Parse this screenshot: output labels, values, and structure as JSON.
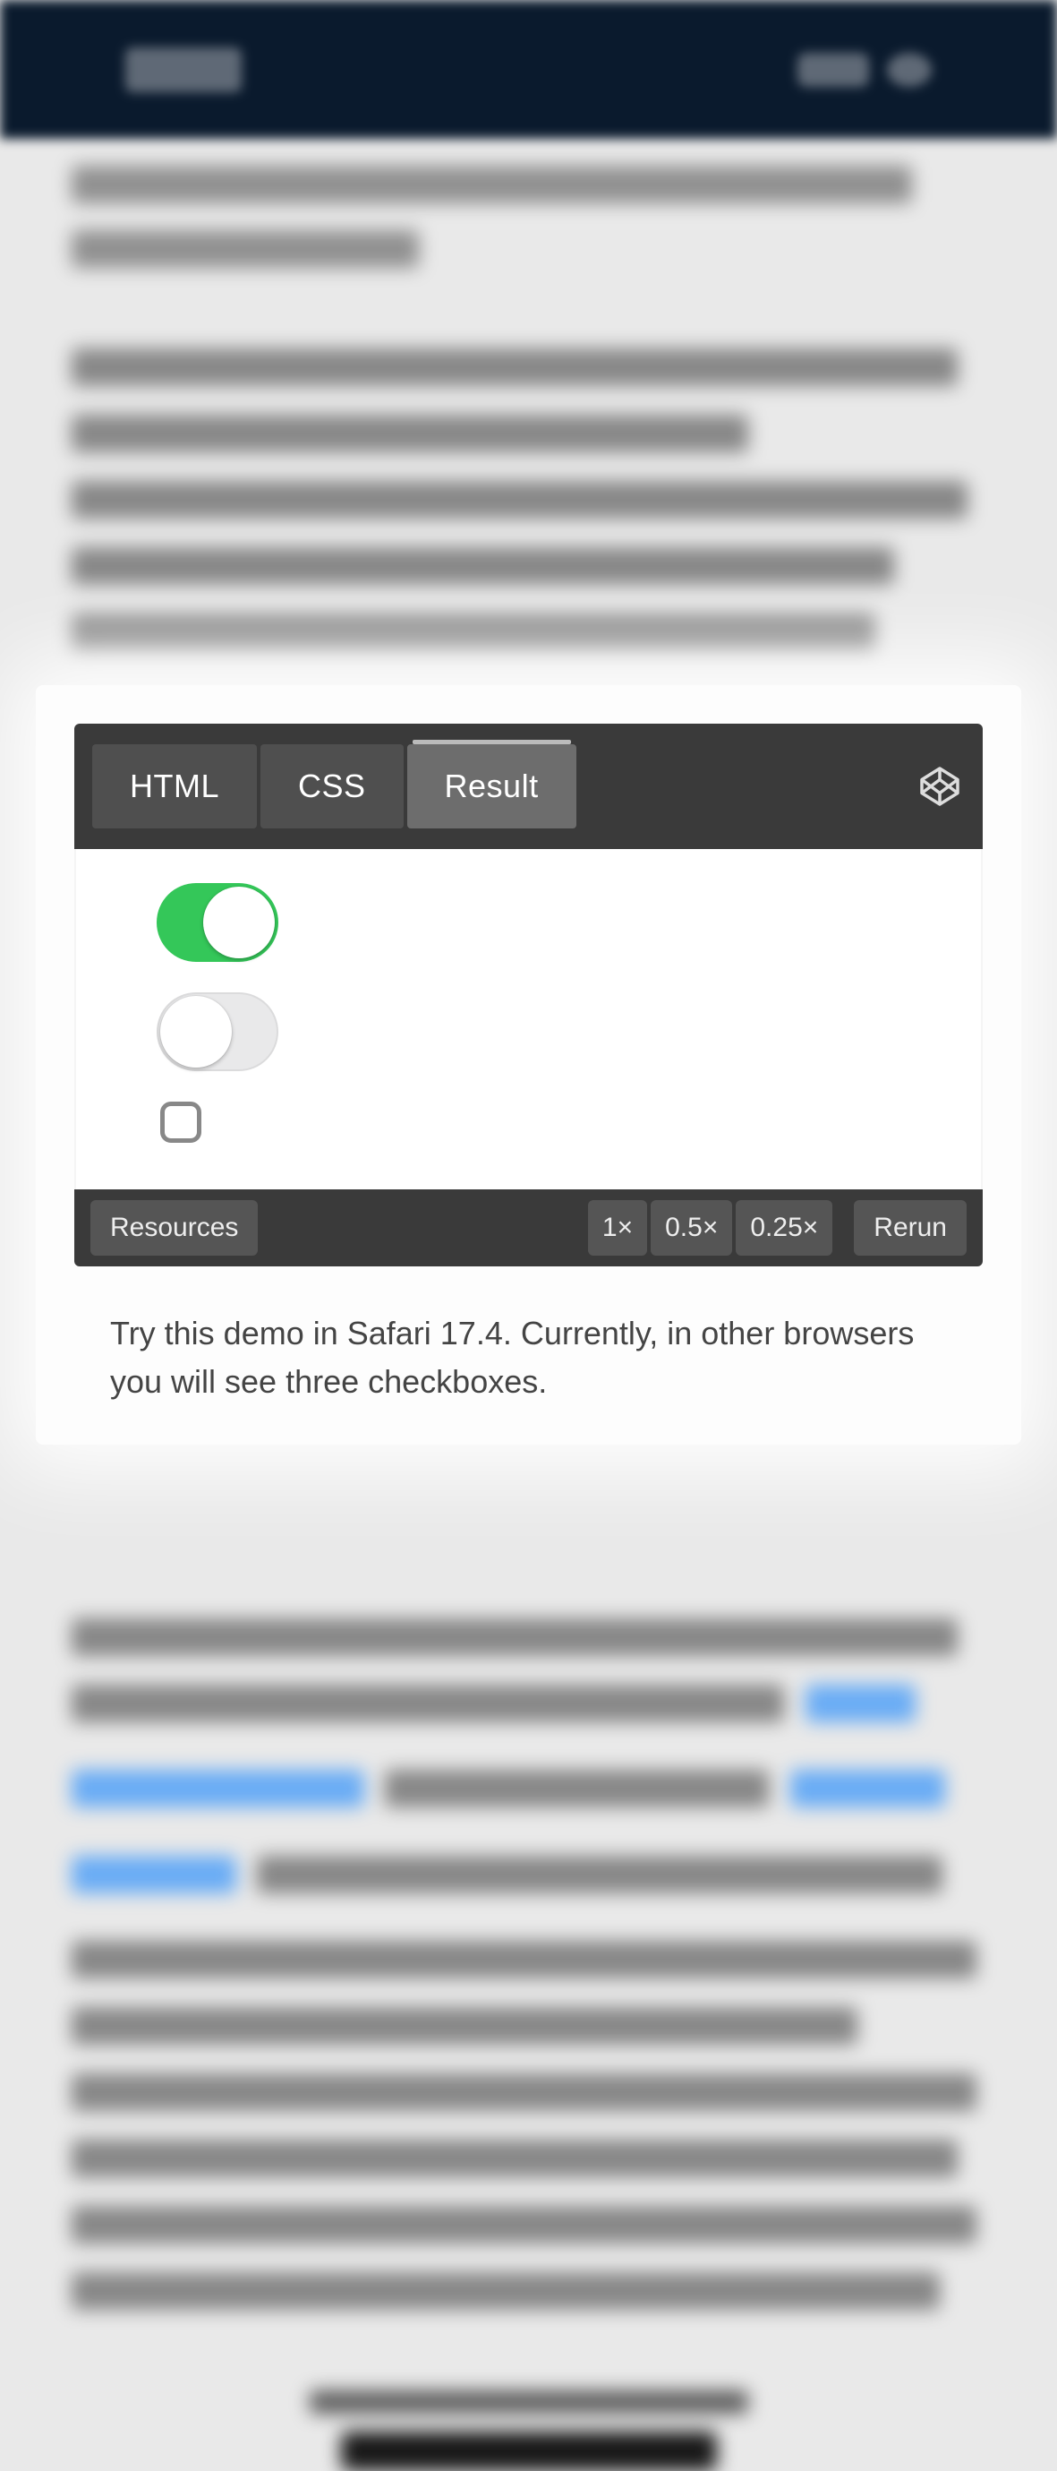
{
  "codepen": {
    "tabs": {
      "html": "HTML",
      "css": "CSS",
      "result": "Result"
    },
    "active_tab": "result",
    "footer": {
      "resources": "Resources",
      "zoom": {
        "z1": "1×",
        "z05": "0.5×",
        "z025": "0.25×"
      },
      "rerun": "Rerun"
    }
  },
  "result_controls": {
    "switch_on": {
      "state": "on"
    },
    "switch_off": {
      "state": "off"
    },
    "checkbox": {
      "checked": false
    }
  },
  "caption": "Try this demo in Safari 17.4. Currently, in other browsers you will see three checkboxes."
}
